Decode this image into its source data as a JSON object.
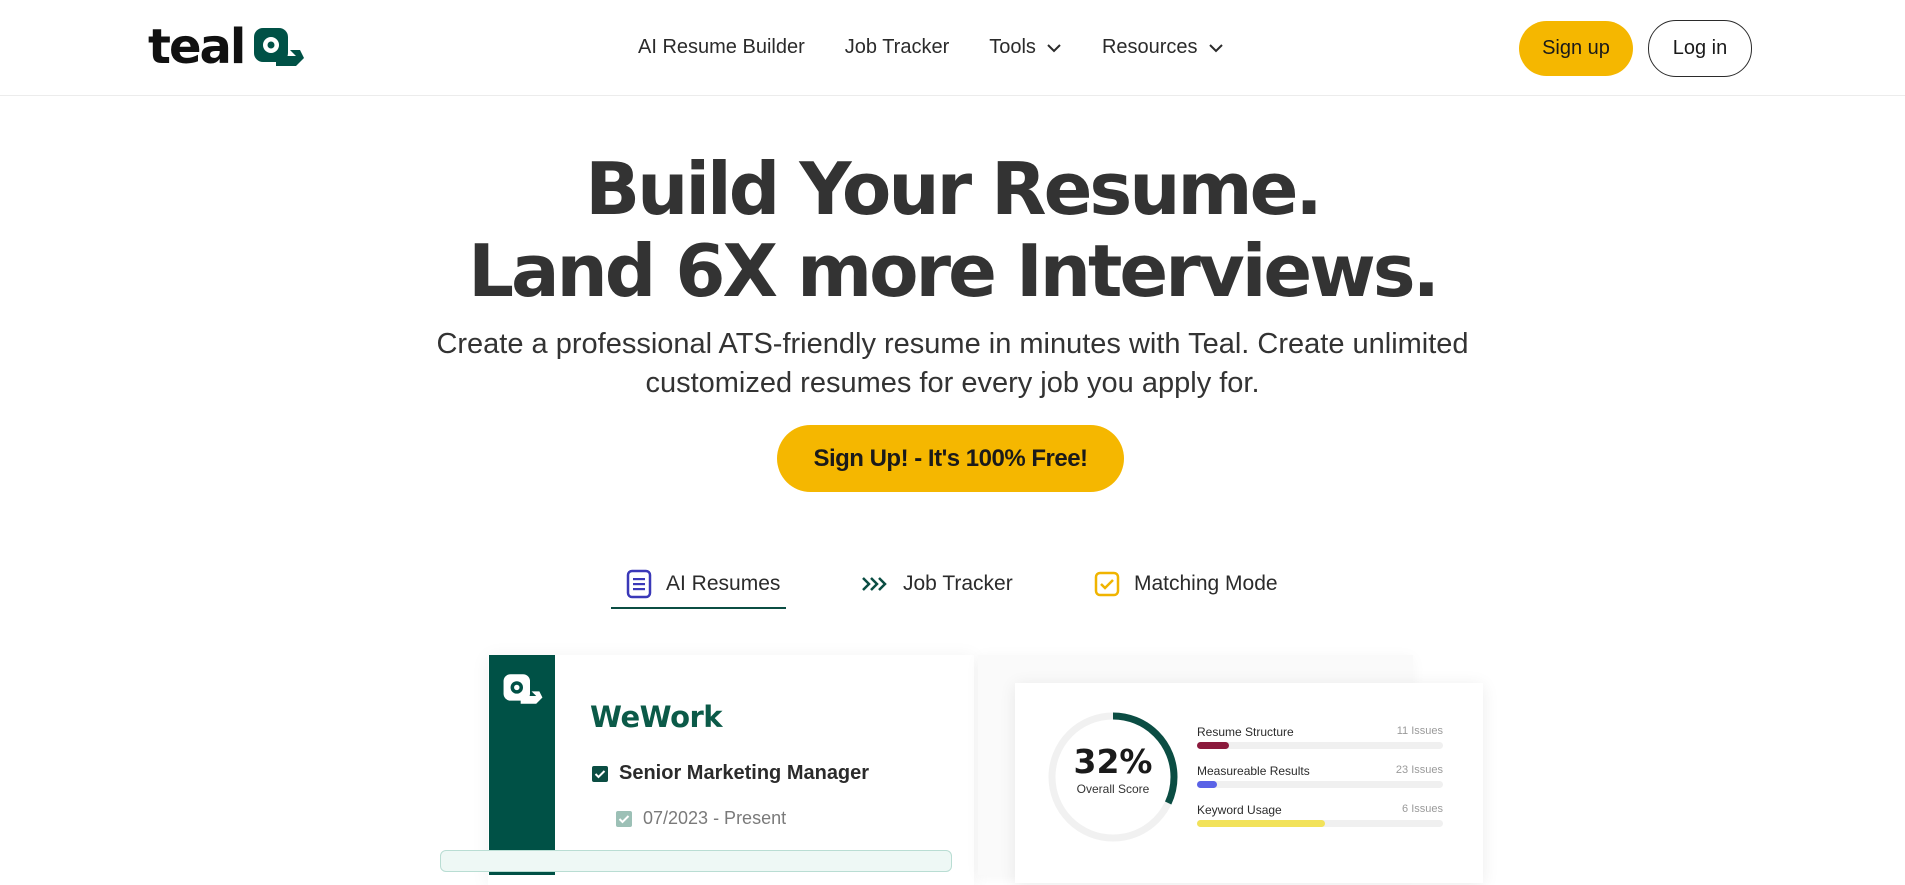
{
  "header": {
    "logo_text": "teal",
    "nav": [
      {
        "label": "AI Resume Builder",
        "has_dropdown": false
      },
      {
        "label": "Job Tracker",
        "has_dropdown": false
      },
      {
        "label": "Tools",
        "has_dropdown": true
      },
      {
        "label": "Resources",
        "has_dropdown": true
      }
    ],
    "signup_label": "Sign up",
    "login_label": "Log in"
  },
  "hero": {
    "title_line1": "Build Your Resume.",
    "title_line2": "Land 6X more Interviews.",
    "subtitle": "Create a professional ATS-friendly resume in minutes with Teal. Create unlimited customized resumes for every job you apply for.",
    "cta_label": "Sign Up! - It's 100% Free!"
  },
  "tabs": [
    {
      "label": "AI Resumes",
      "icon": "document-icon",
      "active": true
    },
    {
      "label": "Job Tracker",
      "icon": "chevrons-right-icon",
      "active": false
    },
    {
      "label": "Matching Mode",
      "icon": "checkbox-icon",
      "active": false
    }
  ],
  "preview": {
    "resume": {
      "company": "WeWork",
      "role": "Senior Marketing Manager",
      "dates": "07/2023 - Present"
    },
    "score": {
      "value": "32%",
      "percent": 32,
      "label": "Overall Score",
      "metrics": [
        {
          "name": "Resume Structure",
          "issues": "11 Issues",
          "fill": 0.13,
          "color": "#8b1a3c"
        },
        {
          "name": "Measureable Results",
          "issues": "23 Issues",
          "fill": 0.08,
          "color": "#5a62e6"
        },
        {
          "name": "Keyword Usage",
          "issues": "6 Issues",
          "fill": 0.52,
          "color": "#f2e25a"
        }
      ]
    }
  },
  "colors": {
    "brand_green": "#005146",
    "accent_yellow": "#f5b700",
    "text": "#333333"
  }
}
